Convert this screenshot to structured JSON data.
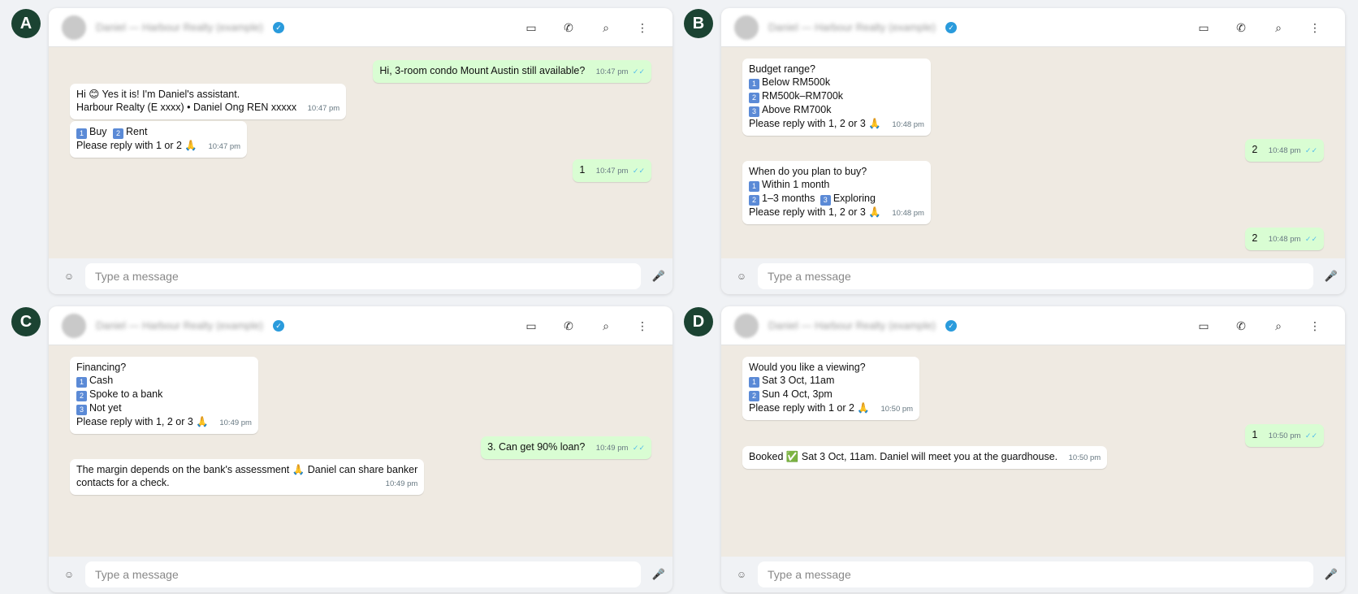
{
  "common": {
    "contact_name": "Daniel — Harbour Realty (example)",
    "verified_icon": "✓",
    "placeholder": "Type a message",
    "emoji_icon": "☺",
    "mic_icon": "🎤",
    "video_icon": "▭",
    "call_icon": "✆",
    "search_icon": "⌕",
    "menu_icon": "⋮",
    "ticks": "✓✓"
  },
  "panels": {
    "a": {
      "label": "A",
      "messages": [
        {
          "lines": [
            "Hi, 3-room condo Mount Austin still available?"
          ],
          "time": "10:47 pm"
        },
        {
          "lines": [
            "Hi 😊 Yes it is! I'm Daniel's assistant.",
            "Harbour Realty (E xxxx)  •  Daniel Ong REN xxxxx"
          ],
          "time": "10:47 pm"
        },
        {
          "lines": [
            "1",
            "Buy",
            "2",
            "Rent",
            "Please reply with 1 or 2 🙏"
          ],
          "time": "10:47 pm"
        },
        {
          "lines": [
            "1"
          ],
          "time": "10:47 pm"
        }
      ]
    },
    "b": {
      "label": "B",
      "messages": [
        {
          "lines": [
            "Budget range?",
            "1",
            "Below RM500k",
            "2",
            "RM500k–RM700k",
            "3",
            "Above RM700k",
            "Please reply with 1, 2 or 3 🙏"
          ],
          "time": "10:48 pm"
        },
        {
          "lines": [
            "2"
          ],
          "time": "10:48 pm"
        },
        {
          "lines": [
            "When do you plan to buy?",
            "1",
            "Within 1 month",
            "2",
            "1–3 months",
            "3",
            "Exploring",
            "Please reply with 1, 2 or 3 🙏"
          ],
          "time": "10:48 pm"
        },
        {
          "lines": [
            "2"
          ],
          "time": "10:48 pm"
        }
      ]
    },
    "c": {
      "label": "C",
      "messages": [
        {
          "lines": [
            "Financing?",
            "1",
            "Cash",
            "2",
            "Spoke to a bank",
            "3",
            "Not yet",
            "Please reply with 1, 2 or 3 🙏"
          ],
          "time": "10:49 pm"
        },
        {
          "lines": [
            "3. Can get 90% loan?"
          ],
          "time": "10:49 pm"
        },
        {
          "lines": [
            "The margin depends on the bank's assessment 🙏 Daniel can share banker",
            "contacts for a check."
          ],
          "time": "10:49 pm"
        }
      ]
    },
    "d": {
      "label": "D",
      "messages": [
        {
          "lines": [
            "Would you like a viewing?",
            "1",
            "Sat 3 Oct, 11am",
            "2",
            "Sun 4 Oct, 3pm",
            "Please reply with 1 or 2 🙏"
          ],
          "time": "10:50 pm"
        },
        {
          "lines": [
            "1"
          ],
          "time": "10:50 pm"
        },
        {
          "lines": [
            "Booked ✅ Sat 3 Oct, 11am. Daniel will meet you at the guardhouse."
          ],
          "time": "10:50 pm"
        }
      ]
    }
  }
}
